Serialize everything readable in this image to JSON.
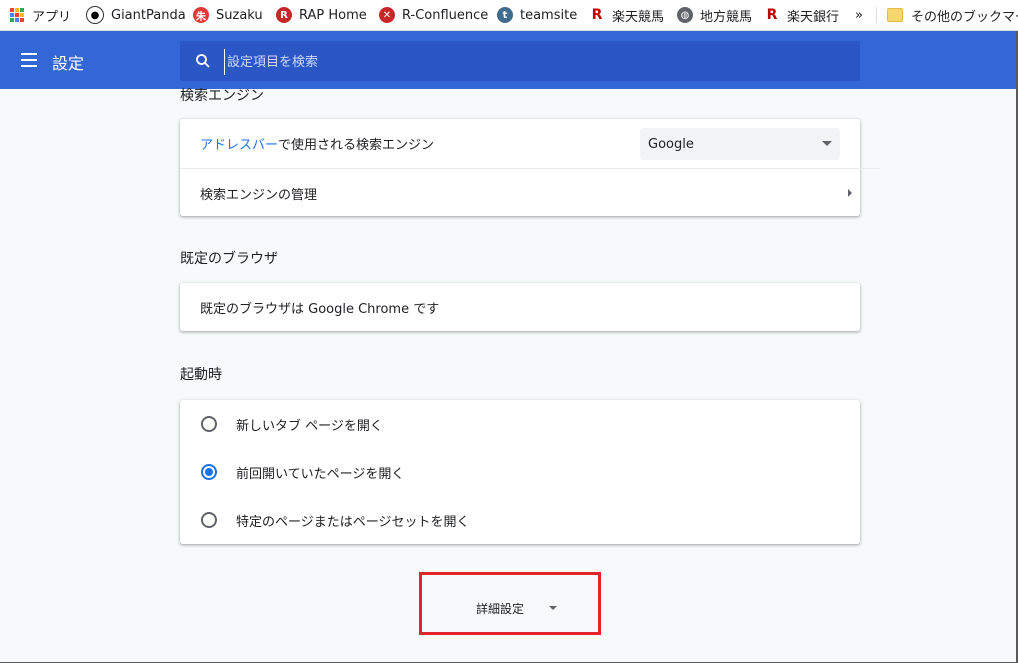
{
  "bookmarks": {
    "apps": "アプリ",
    "items": [
      {
        "label": "GiantPanda",
        "icon": "panda-icon"
      },
      {
        "label": "Suzaku",
        "icon": "suzaku-icon"
      },
      {
        "label": "RAP Home",
        "icon": "rap-icon"
      },
      {
        "label": "R-Confluence",
        "icon": "confluence-icon"
      },
      {
        "label": "teamsite",
        "icon": "teamsite-icon"
      },
      {
        "label": "楽天競馬",
        "icon": "rakuten-r-icon"
      },
      {
        "label": "地方競馬",
        "icon": "globe-icon"
      },
      {
        "label": "楽天銀行",
        "icon": "rakuten-r-icon"
      }
    ],
    "overflow": "»",
    "other": "その他のブックマー"
  },
  "header": {
    "title": "設定",
    "search_placeholder": "設定項目を検索"
  },
  "search_engine": {
    "section_title": "検索エンジン",
    "row1_link": "アドレスバー",
    "row1_text": "で使用される検索エンジン",
    "selected": "Google",
    "row2": "検索エンジンの管理"
  },
  "default_browser": {
    "section_title": "既定のブラウザ",
    "text": "既定のブラウザは Google Chrome です"
  },
  "on_startup": {
    "section_title": "起動時",
    "options": [
      {
        "label": "新しいタブ ページを開く",
        "checked": false
      },
      {
        "label": "前回開いていたページを開く",
        "checked": true
      },
      {
        "label": "特定のページまたはページセットを開く",
        "checked": false
      }
    ]
  },
  "advanced": {
    "label": "詳細設定"
  },
  "colors": {
    "header": "#3367d6",
    "accent": "#1a73e8",
    "highlight": "#e3242b"
  }
}
